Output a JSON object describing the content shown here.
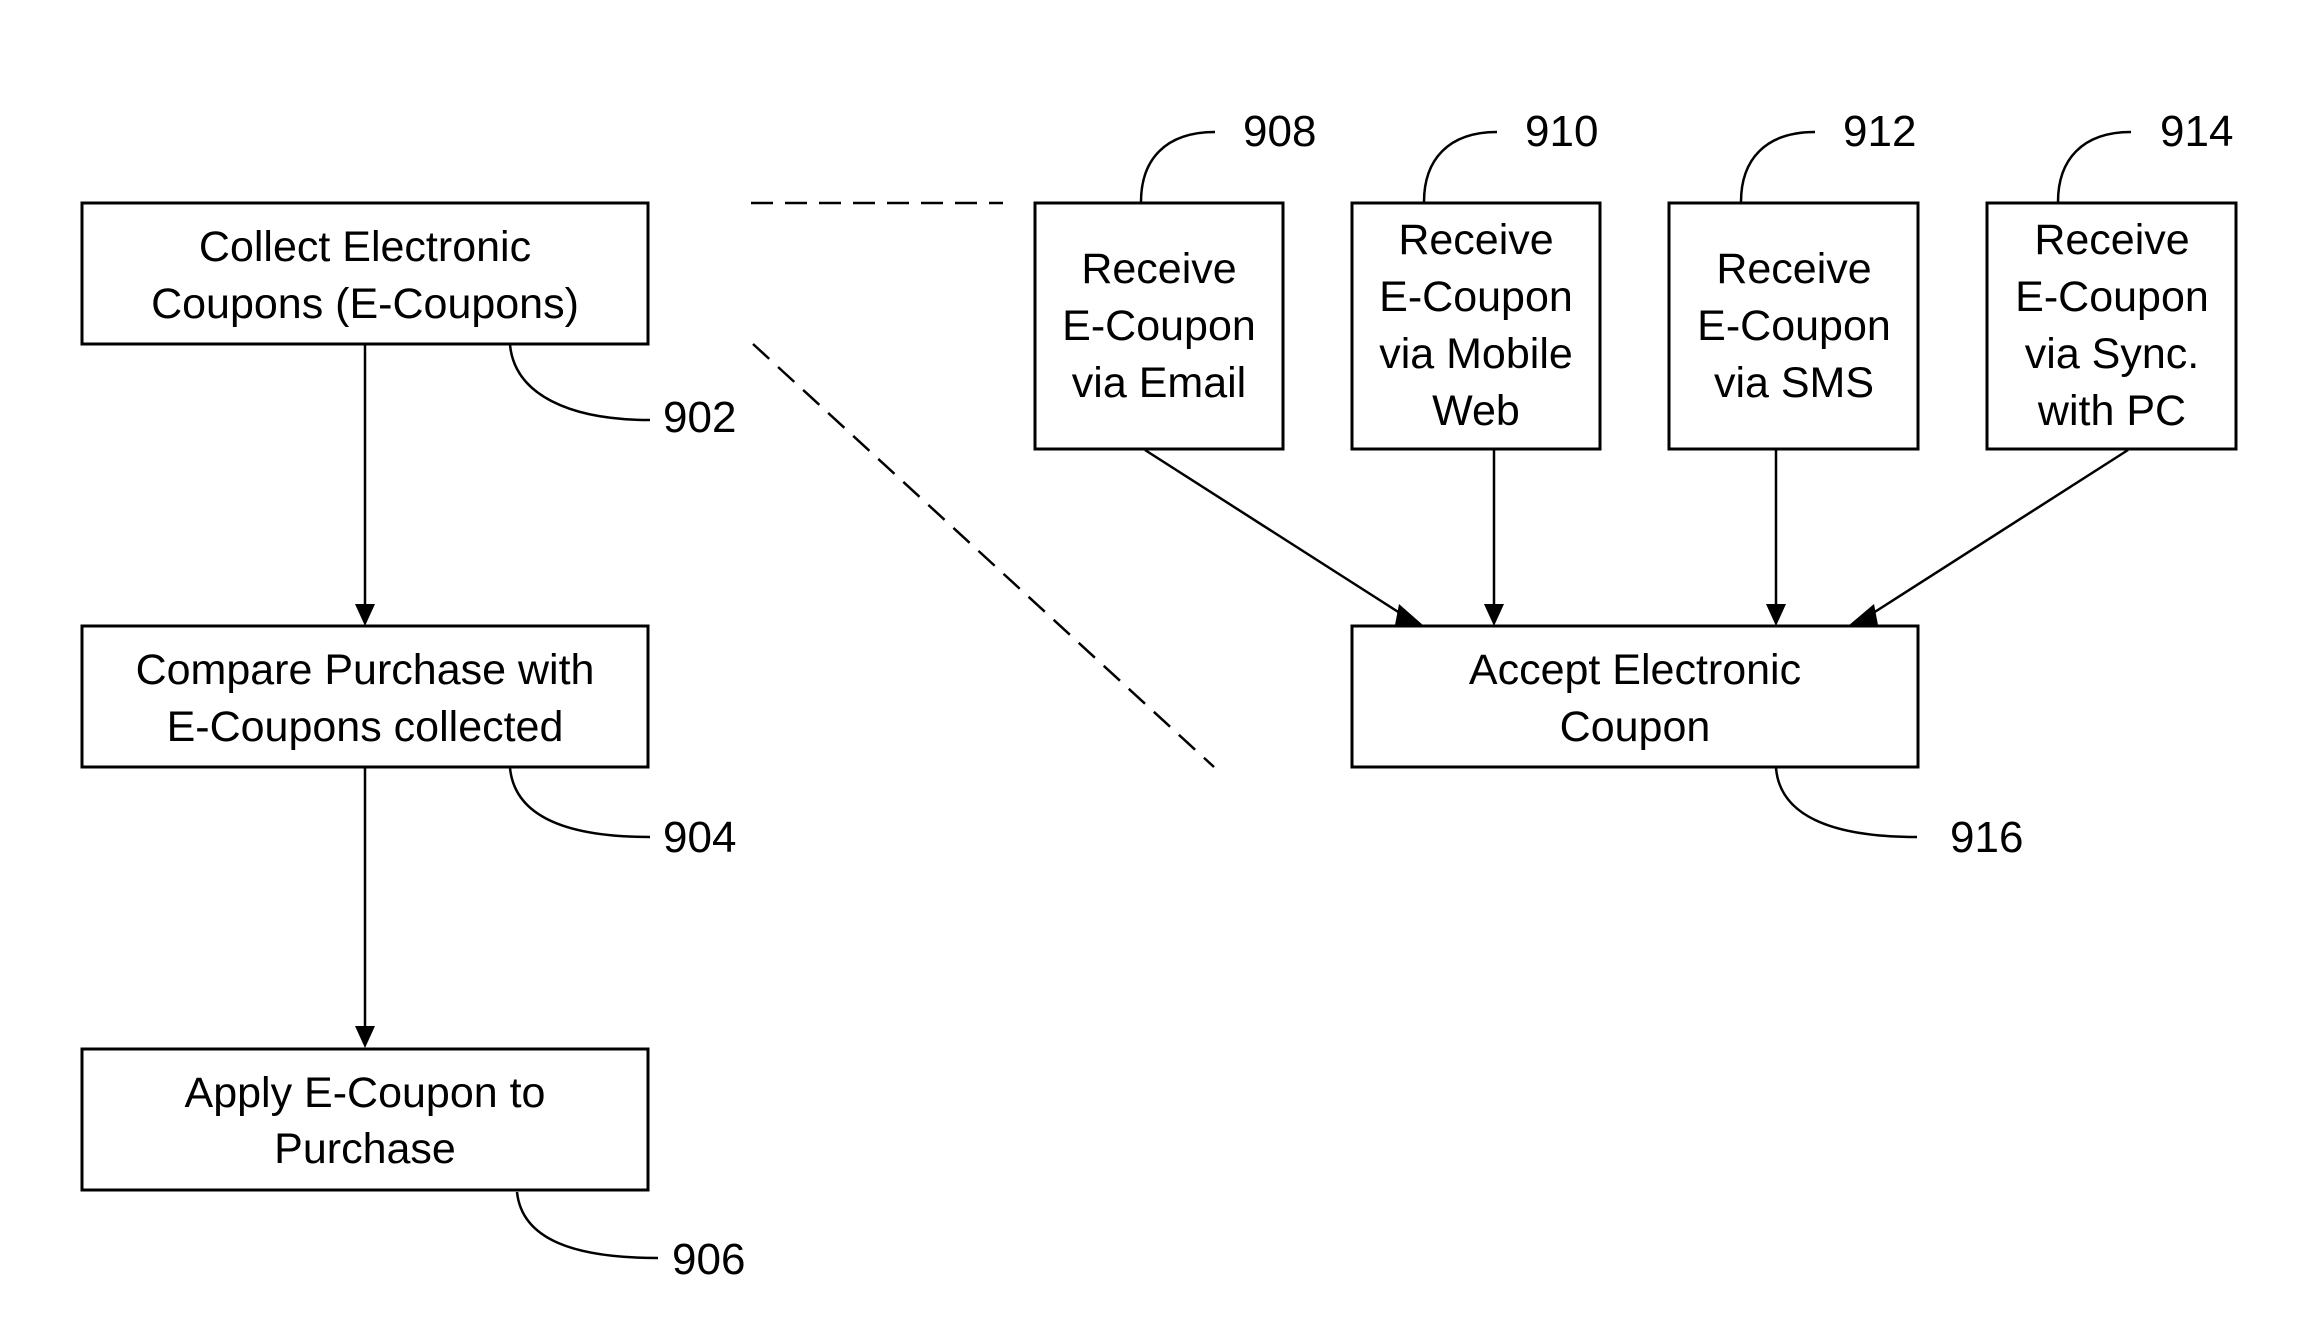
{
  "diagram": {
    "left_flow": {
      "steps": [
        {
          "ref": "902",
          "lines": [
            "Collect Electronic",
            "Coupons (E-Coupons)"
          ]
        },
        {
          "ref": "904",
          "lines": [
            "Compare Purchase with",
            "E-Coupons collected"
          ]
        },
        {
          "ref": "906",
          "lines": [
            "Apply E-Coupon to",
            "Purchase"
          ]
        }
      ]
    },
    "detail_flow": {
      "sources": [
        {
          "ref": "908",
          "lines": [
            "Receive",
            "E-Coupon",
            "via Email"
          ]
        },
        {
          "ref": "910",
          "lines": [
            "Receive",
            "E-Coupon",
            "via Mobile",
            "Web"
          ]
        },
        {
          "ref": "912",
          "lines": [
            "Receive",
            "E-Coupon",
            "via SMS"
          ]
        },
        {
          "ref": "914",
          "lines": [
            "Receive",
            "E-Coupon",
            "via Sync.",
            "with PC"
          ]
        }
      ],
      "target": {
        "ref": "916",
        "lines": [
          "Accept Electronic",
          "Coupon"
        ]
      }
    },
    "colors": {
      "stroke": "#000000",
      "background": "#ffffff"
    }
  }
}
